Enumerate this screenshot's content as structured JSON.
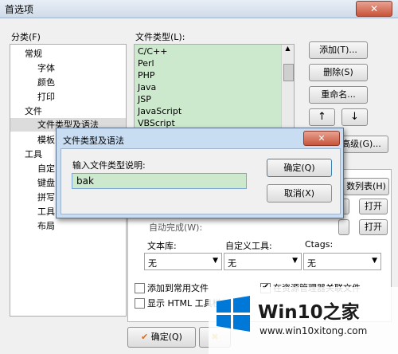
{
  "window": {
    "title": "首选项",
    "close": "✕"
  },
  "category": {
    "label": "分类(F)",
    "items": [
      "常规",
      "字体",
      "颜色",
      "打印",
      "文件",
      "文件类型及语法",
      "模板",
      "工具",
      "自定",
      "键盘",
      "拼写",
      "工具",
      "布局"
    ]
  },
  "filetypes": {
    "label": "文件类型(L):",
    "items": [
      "C/C++",
      "Perl",
      "PHP",
      "Java",
      "JSP",
      "JavaScript",
      "VBScript"
    ]
  },
  "buttons": {
    "add": "添加(T)...",
    "delete": "删除(S)",
    "rename": "重命名...",
    "up": "↑",
    "down": "↓",
    "advanced": "高级(G)...",
    "numlist": "数列表(H)",
    "open1": "打开",
    "open2": "打开",
    "ok": "确定(Q)"
  },
  "panel": {
    "autocomplete": "自动完成(W):",
    "textlib_label": "文本库:",
    "textlib_value": "无",
    "customtool_label": "自定义工具:",
    "customtool_value": "无",
    "ctags_label": "Ctags:",
    "ctags_value": "无",
    "add_common": "添加到常用文件",
    "show_html": "显示 HTML 工具栏",
    "explorer_assoc": "在资源管理器关联文件"
  },
  "dialog": {
    "title": "文件类型及语法",
    "close": "✕",
    "prompt": "输入文件类型说明:",
    "input_value": "bak",
    "ok": "确定(Q)",
    "cancel": "取消(X)"
  },
  "watermark": {
    "logo_text": "Win10之家",
    "url": "www.win10xitong.com"
  },
  "colors": {
    "list_bg": "#cde9cd",
    "win_blue": "#0078d7"
  }
}
